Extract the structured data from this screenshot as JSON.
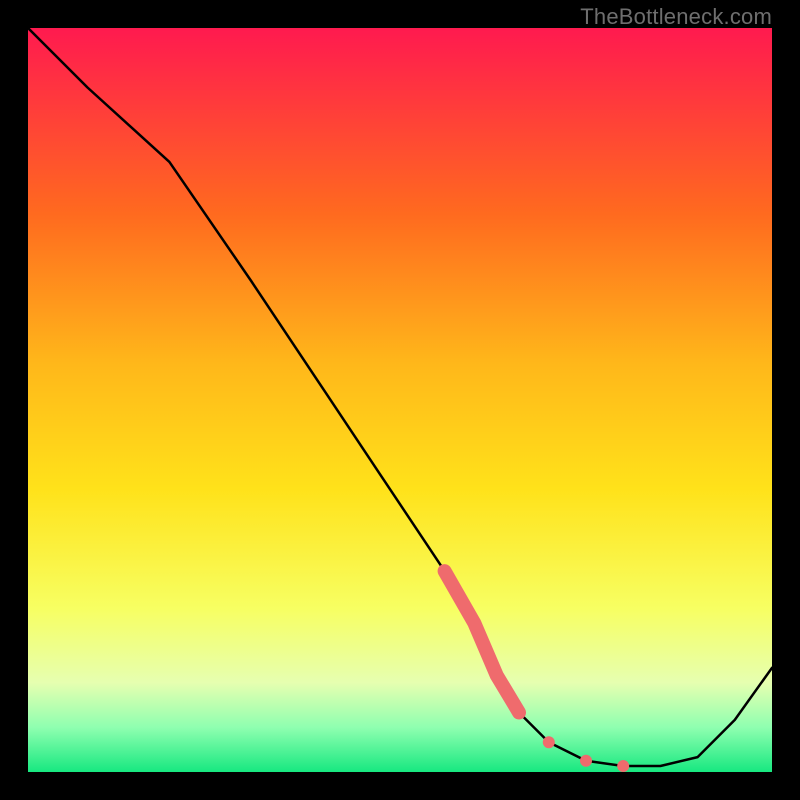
{
  "watermark": "TheBottleneck.com",
  "chart_data": {
    "type": "line",
    "title": "",
    "xlabel": "",
    "ylabel": "",
    "xlim": [
      0,
      100
    ],
    "ylim": [
      0,
      100
    ],
    "grid": false,
    "series": [
      {
        "name": "curve",
        "x": [
          0,
          8,
          19,
          30,
          40,
          50,
          56,
          60,
          63,
          66,
          70,
          75,
          80,
          85,
          90,
          95,
          100
        ],
        "y": [
          100,
          92,
          82,
          66,
          51,
          36,
          27,
          20,
          13,
          8,
          4,
          1.5,
          0.8,
          0.8,
          2,
          7,
          14
        ]
      }
    ],
    "highlight_segment": {
      "x": [
        56,
        60,
        63,
        66
      ],
      "y": [
        27,
        20,
        13,
        8
      ]
    },
    "dots": [
      {
        "x": 70,
        "y": 4
      },
      {
        "x": 75,
        "y": 1.5
      },
      {
        "x": 80,
        "y": 0.8
      }
    ],
    "background_gradient": {
      "top": "#ff1a4f",
      "mid1": "#ff8a1f",
      "mid2": "#ffe21a",
      "mid3": "#f7ff62",
      "low": "#a6ff8e",
      "bottom": "#17e880"
    }
  }
}
